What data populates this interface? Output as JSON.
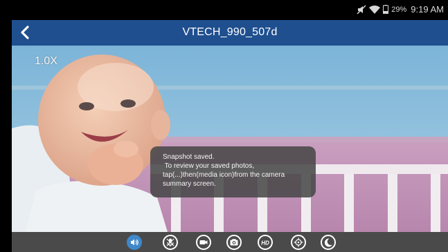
{
  "status_bar": {
    "battery": "29%",
    "time": "9:19 AM",
    "icons": [
      "mute-icon",
      "wifi-icon",
      "battery-icon"
    ]
  },
  "header": {
    "title": "VTECH_990_507d",
    "back_icon": "back-chevron-icon"
  },
  "video": {
    "zoom": "1.0X"
  },
  "toast": {
    "lines": [
      "Snapshot saved.",
      " To review your saved photos,",
      "tap(...)then(media icon)from the camera",
      "summary screen."
    ]
  },
  "toolbar": {
    "buttons": [
      {
        "name": "speaker",
        "icon": "speaker-icon",
        "active": true
      },
      {
        "name": "mic-mute",
        "icon": "mic-mute-icon",
        "active": false
      },
      {
        "name": "video-record",
        "icon": "video-camera-icon",
        "active": false
      },
      {
        "name": "snapshot",
        "icon": "camera-icon",
        "active": false
      },
      {
        "name": "hd",
        "icon": "hd-icon",
        "label": "HD",
        "active": false
      },
      {
        "name": "pan-tilt",
        "icon": "crosshair-icon",
        "active": false
      },
      {
        "name": "night-light",
        "icon": "moon-icon",
        "active": false
      }
    ],
    "active_color": "#3f88c9"
  },
  "colors": {
    "title_bar": "#1f4f8f",
    "toolbar": "#4a4a4a"
  }
}
